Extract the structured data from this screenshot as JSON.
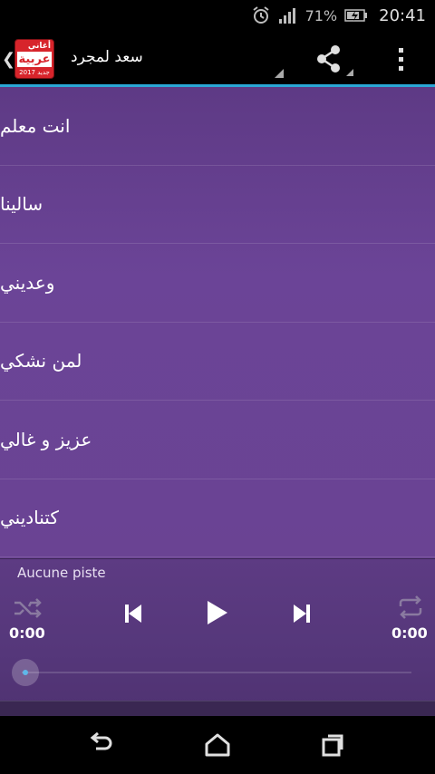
{
  "status_bar": {
    "alarm_icon": "alarm-clock-icon",
    "signal_icon": "cell-signal-icon",
    "battery_percent": "71%",
    "battery_icon": "battery-charging-icon",
    "clock": "20:41"
  },
  "action_bar": {
    "logo_text_top": "أغاني",
    "logo_text_main": "عربية",
    "logo_text_bottom": "جديد 2017",
    "title": "سعد لمجرد",
    "share_icon": "share-icon",
    "overflow_icon": "overflow-menu-icon",
    "accent_color": "#2aa7d6"
  },
  "songs": [
    {
      "title": "انت معلم"
    },
    {
      "title": "سالينا"
    },
    {
      "title": "وعديني"
    },
    {
      "title": "لمن نشكي"
    },
    {
      "title": "عزيز و غالي"
    },
    {
      "title": "كتناديني"
    }
  ],
  "player": {
    "track_name": "Aucune piste",
    "elapsed": "0:00",
    "duration": "0:00",
    "progress": 0,
    "shuffle_icon": "shuffle-icon",
    "prev_icon": "skip-previous-icon",
    "play_icon": "play-icon",
    "next_icon": "skip-next-icon",
    "repeat_icon": "repeat-icon"
  },
  "nav_bar": {
    "back_icon": "back-icon",
    "home_icon": "home-icon",
    "recents_icon": "recent-apps-icon"
  }
}
